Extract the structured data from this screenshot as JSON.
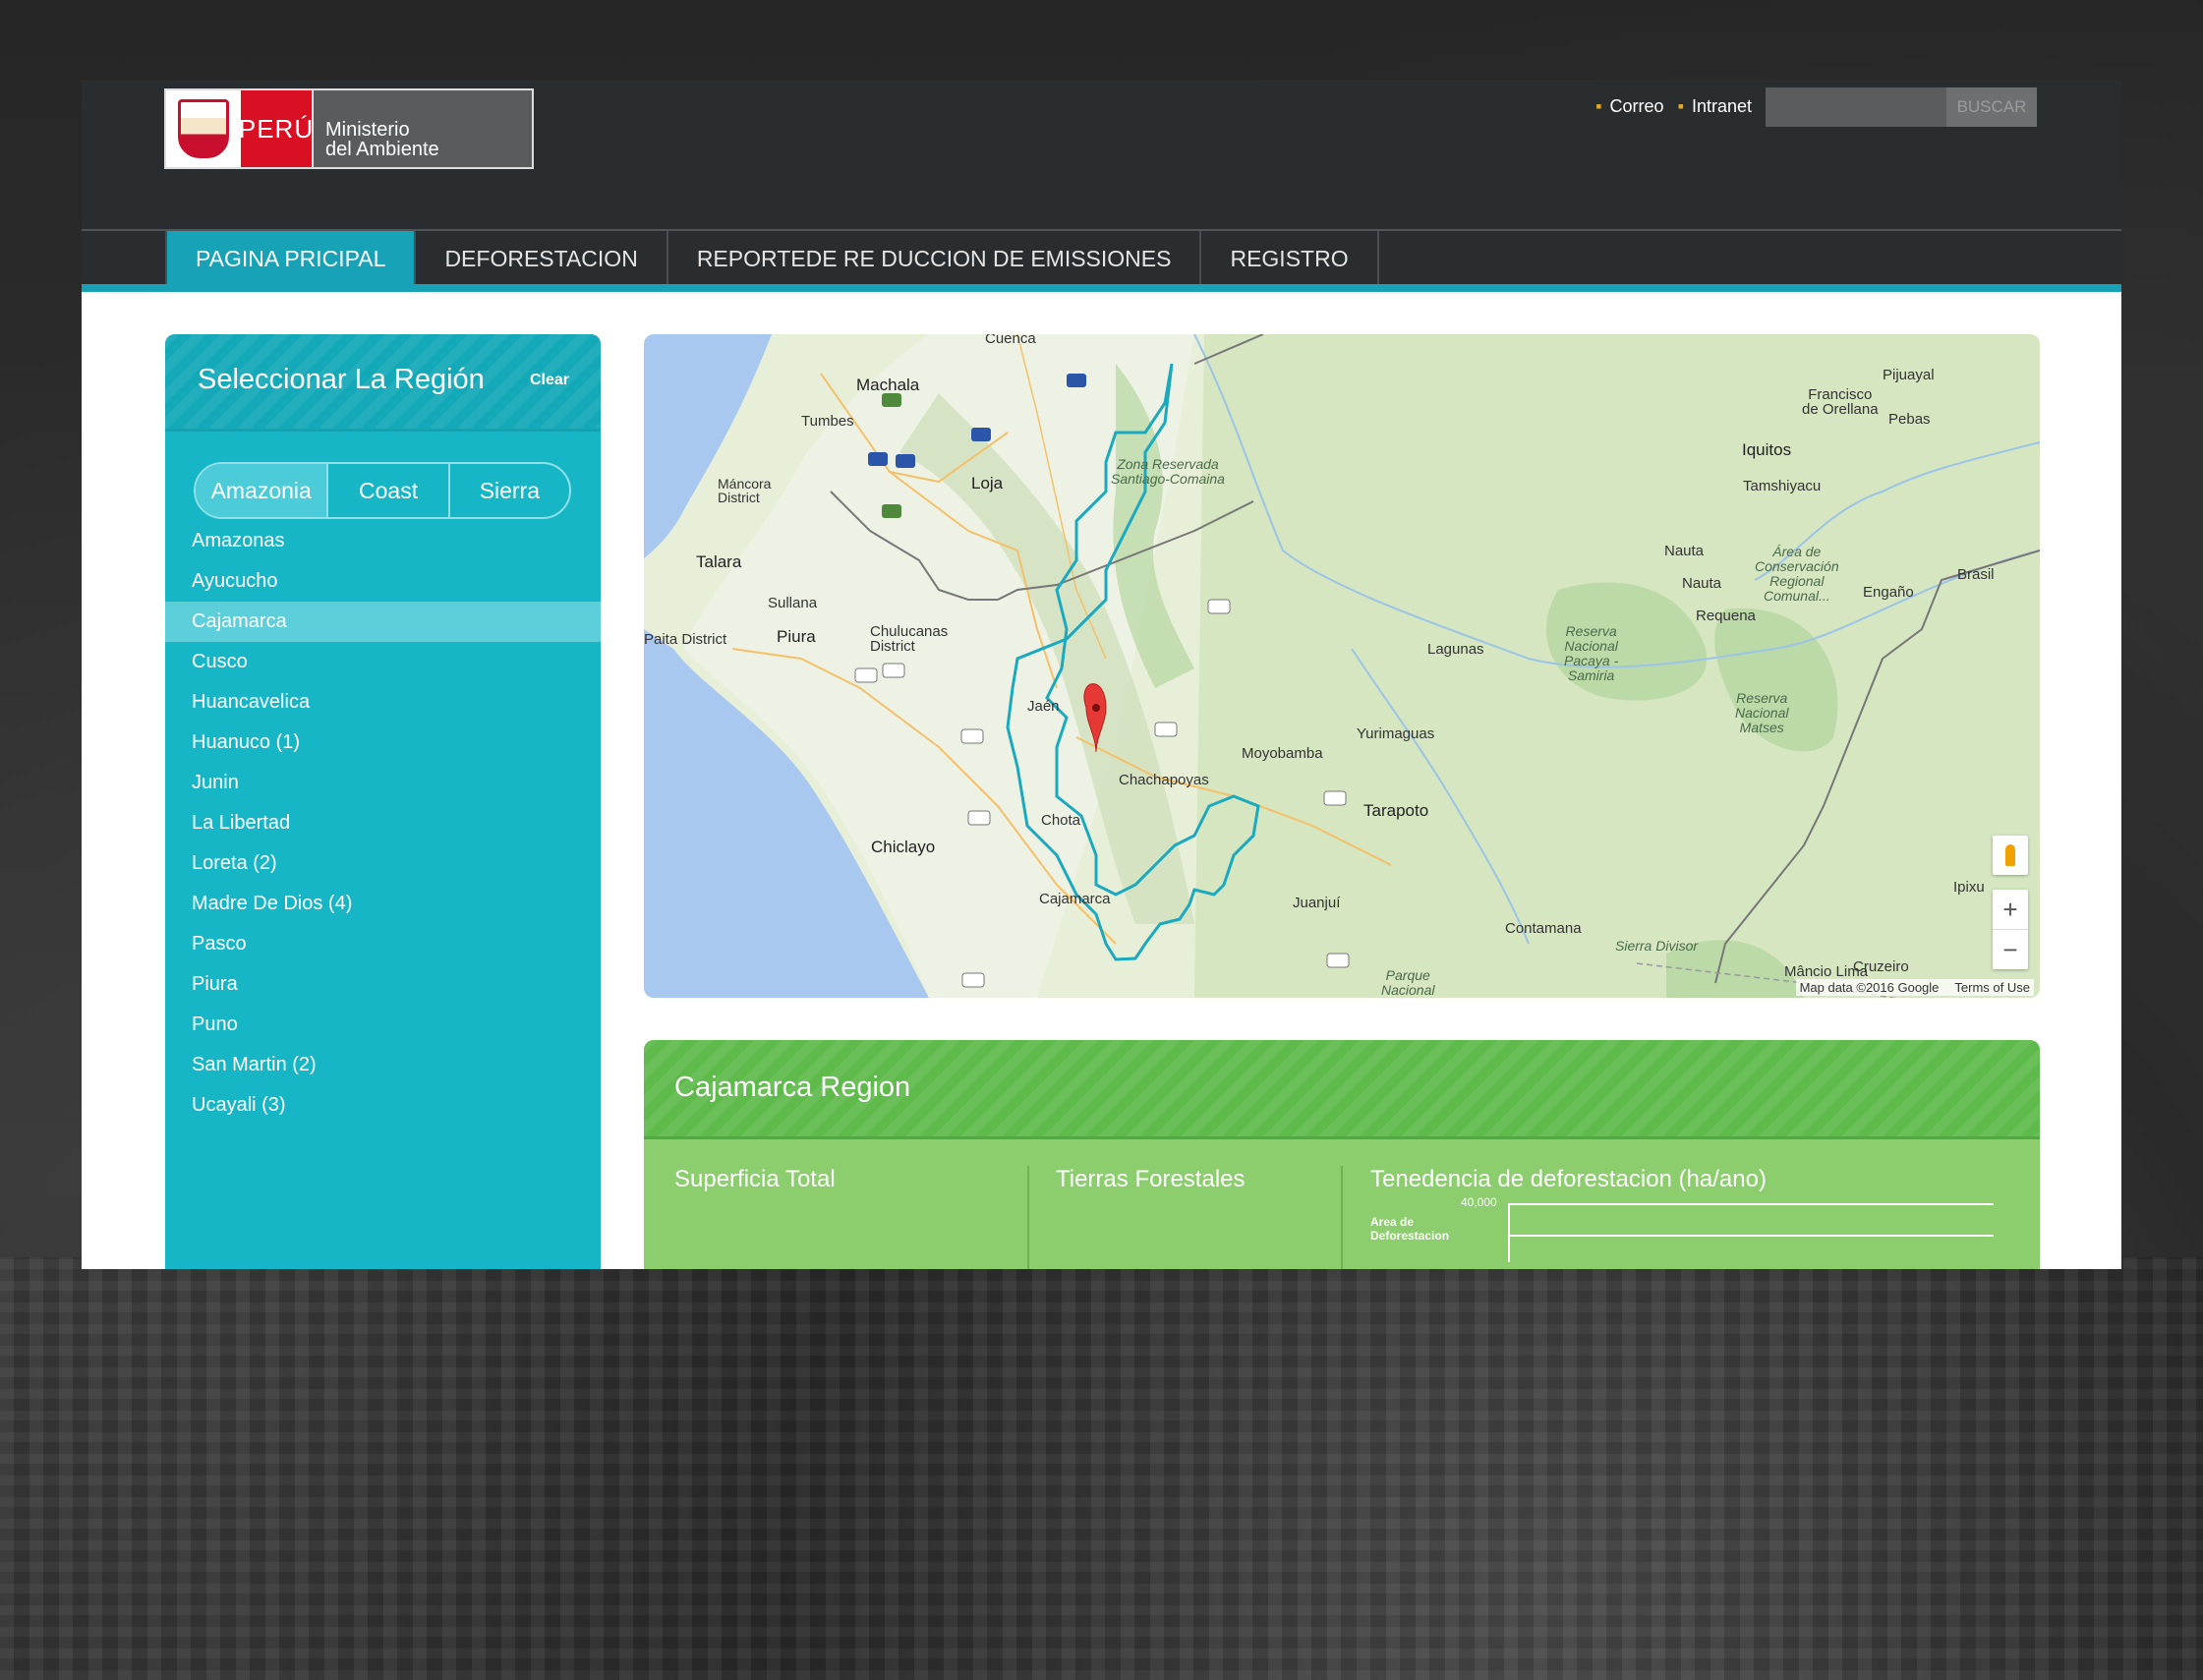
{
  "header": {
    "logo": {
      "country": "PERÚ",
      "ministry_line1": "Ministerio",
      "ministry_line2": "del Ambiente"
    },
    "links": [
      "Correo",
      "Intranet"
    ],
    "search": {
      "placeholder": "",
      "button": "BUSCAR"
    }
  },
  "nav": {
    "tabs": [
      {
        "label": "PAGINA PRICIPAL",
        "active": true
      },
      {
        "label": "DEFORESTACION",
        "active": false
      },
      {
        "label": "REPORTEDE RE DUCCION DE EMISSIONES",
        "active": false
      },
      {
        "label": "REGISTRO",
        "active": false
      }
    ]
  },
  "sidebar": {
    "title": "Seleccionar La Región",
    "clear": "Clear",
    "segments": [
      "Amazonia",
      "Coast",
      "Sierra"
    ],
    "active_segment": "Amazonia",
    "regions": [
      "Amazonas",
      "Ayucucho",
      "Cajamarca",
      "Cusco",
      "Huancavelica",
      "Huanuco (1)",
      "Junin",
      "La Libertad",
      "Loreta (2)",
      "Madre De Dios (4)",
      "Pasco",
      "Piura",
      "Puno",
      "San Martin (2)",
      "Ucayali (3)"
    ],
    "selected_region": "Cajamarca"
  },
  "map": {
    "labels": {
      "cuenca": "Cuenca",
      "machala": "Machala",
      "tumbes": "Tumbes",
      "mancora": "Máncora\nDistrict",
      "loja": "Loja",
      "talara": "Talara",
      "sullana": "Sullana",
      "paita": "Paita District",
      "piura": "Piura",
      "chulucanas": "Chulucanas\nDistrict",
      "jaen": "Jaén",
      "chachapoyas": "Chachapoyas",
      "moyobamba": "Moyobamba",
      "tarapoto": "Tarapoto",
      "chiclayo": "Chiclayo",
      "chota": "Chota",
      "cajamarca": "Cajamarca",
      "juanjui": "Juanjuí",
      "yurimaguas": "Yurimaguas",
      "lagunas": "Lagunas",
      "requena": "Requena",
      "nauta": "Nauta",
      "iquitos": "Iquitos",
      "tamshiyacu": "Tamshiyacu",
      "francisco": "Francisco\nde Orellana",
      "pebas": "Pebas",
      "pijuayal": "Pijuayal",
      "engano": "Engaño",
      "brasil": "Brasil",
      "ipixu": "Ipixu",
      "contamana": "Contamana",
      "cruzeiro": "Cruzeiro",
      "mancio": "Mâncio Lima",
      "zona_res": "Zona Reservada\nSantiago-Comaina",
      "pacaya": "Reserva\nNacional\nPacaya -\nSamiria",
      "matses": "Reserva\nNacional\nMatses",
      "area_cons": "Área de\nConservación\nRegional\nComunal...",
      "sierra_divisor": "Sierra Divisor",
      "parque": "Parque\nNacional"
    },
    "attribution": "Map data ©2016 Google",
    "terms": "Terms of Use",
    "zoom_in": "+",
    "zoom_out": "−"
  },
  "region_panel": {
    "title": "Cajamarca Region",
    "columns": [
      "Superficia Total",
      "Tierras Forestales",
      "Tenedencia de deforestacion (ha/ano)"
    ],
    "chart": {
      "ytick": "40,000",
      "ylabel": "Area de\nDeforestacion"
    }
  },
  "colors": {
    "teal": "#17a2b8",
    "sidebar": "#17b6c7",
    "green": "#5fba4c",
    "nav_bg": "#2a2d30"
  }
}
